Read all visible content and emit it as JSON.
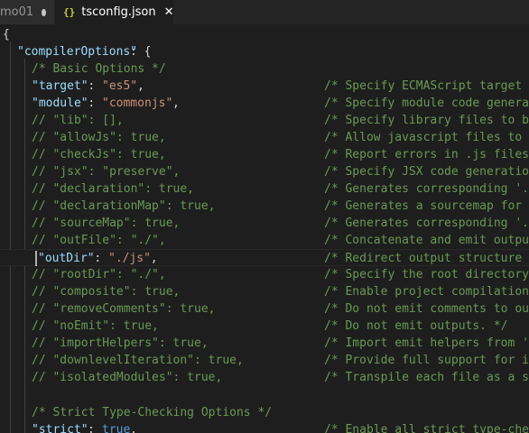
{
  "tabs": [
    {
      "label": "mo01",
      "state": "modified",
      "active": false
    },
    {
      "label": "tsconfig.json",
      "icon": "json-icon",
      "icon_glyph": "{}",
      "active": true,
      "close_glyph": "✕"
    }
  ],
  "code": {
    "open_brace": "{",
    "compiler_options": {
      "key": "\"compilerOptions\"",
      "colon": ": {"
    },
    "basic_header": "/* Basic Options */",
    "strict_header": "/* Strict Type-Checking Options */",
    "options": [
      {
        "key": "\"target\"",
        "sep": ": ",
        "value": "\"es5\"",
        "value_type": "string",
        "end": ",",
        "comment": "/* Specify ECMAScript target v"
      },
      {
        "key": "\"module\"",
        "sep": ": ",
        "value": "\"commonjs\"",
        "value_type": "string",
        "end": ",",
        "comment": "/* Specify module code generat"
      },
      {
        "disabled": "// \"lib\": [],",
        "comment": "/* Specify library files to be"
      },
      {
        "disabled": "// \"allowJs\": true,",
        "comment": "/* Allow javascript files to b"
      },
      {
        "disabled": "// \"checkJs\": true,",
        "comment": "/* Report errors in .js files"
      },
      {
        "disabled": "// \"jsx\": \"preserve\",",
        "comment": "/* Specify JSX code generation"
      },
      {
        "disabled": "// \"declaration\": true,",
        "comment": "/* Generates corresponding '.c"
      },
      {
        "disabled": "// \"declarationMap\": true,",
        "comment": "/* Generates a sourcemap for e"
      },
      {
        "disabled": "// \"sourceMap\": true,",
        "comment": "/* Generates corresponding '.m"
      },
      {
        "disabled": "// \"outFile\": \"./\",",
        "comment": "/* Concatenate and emit output"
      },
      {
        "key": "\"outDir\"",
        "sep": ": ",
        "value": "\"./js\"",
        "value_type": "string",
        "end": ",",
        "comment": "/* Redirect output structure t",
        "current": true
      },
      {
        "disabled": "// \"rootDir\": \"./\",",
        "comment": "/* Specify the root directory"
      },
      {
        "disabled": "// \"composite\": true,",
        "comment": "/* Enable project compilation"
      },
      {
        "disabled": "// \"removeComments\": true,",
        "comment": "/* Do not emit comments to out"
      },
      {
        "disabled": "// \"noEmit\": true,",
        "comment": "/* Do not emit outputs. */"
      },
      {
        "disabled": "// \"importHelpers\": true,",
        "comment": "/* Import emit helpers from 't"
      },
      {
        "disabled": "// \"downlevelIteration\": true,",
        "comment": "/* Provide full support for it"
      },
      {
        "disabled": "// \"isolatedModules\": true,",
        "comment": "/* Transpile each file as a se"
      }
    ],
    "strict": {
      "key": "\"strict\"",
      "sep": ": ",
      "value": "true",
      "value_type": "keyword",
      "end": ",",
      "comment": "/* Enable all strict type-chec"
    }
  },
  "colors": {
    "editor_bg": "#1e1e1e",
    "tabbar_bg": "#252526",
    "key": "#9cdcfe",
    "string": "#ce9178",
    "comment": "#6a9955",
    "keyword": "#569cd6",
    "punctuation": "#d4d4d4",
    "json_icon": "#cbcb41"
  }
}
